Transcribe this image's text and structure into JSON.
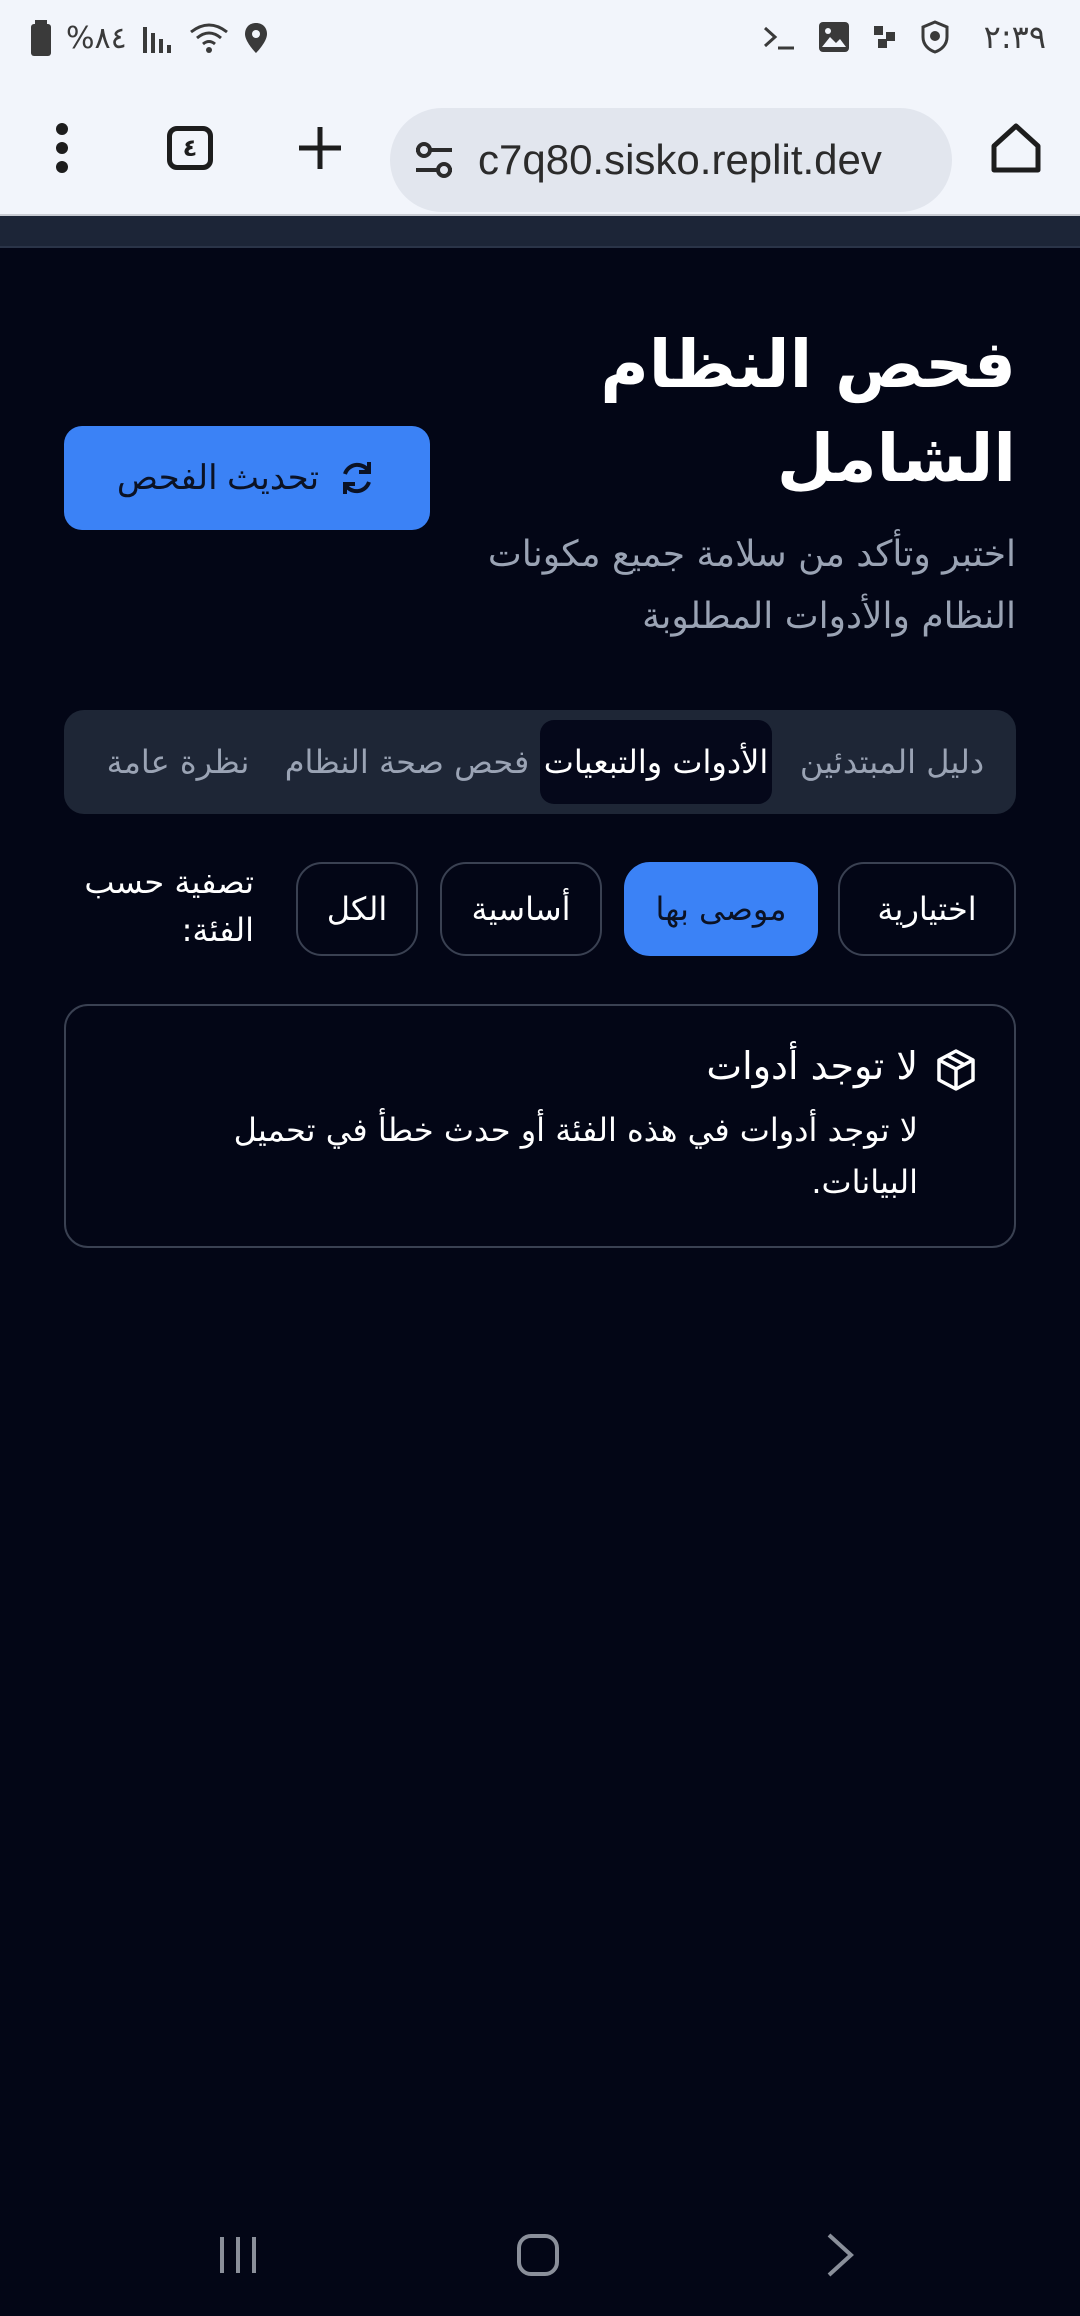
{
  "status_bar": {
    "time": "٢:٣٩",
    "battery": "%٨٤",
    "icons": [
      "terminal-icon",
      "image-icon",
      "shortcut-icon",
      "shield-icon",
      "battery-icon",
      "signal-icon",
      "wifi-icon",
      "location-icon"
    ]
  },
  "browser": {
    "url": "c7q80.sisko.replit.dev",
    "tab_count": "٤",
    "icons": [
      "home-icon",
      "site-settings-icon",
      "new-tab-icon",
      "tabs-icon",
      "menu-icon"
    ]
  },
  "page": {
    "title": "فحص النظام الشامل",
    "subtitle": "اختبر وتأكد من سلامة جميع مكونات النظام والأدوات المطلوبة",
    "refresh_button": "تحديث الفحص"
  },
  "tabs": [
    {
      "label": "دليل المبتدئين",
      "active": false
    },
    {
      "label": "الأدوات والتبعيات",
      "active": true
    },
    {
      "label": "فحص صحة النظام",
      "active": false
    },
    {
      "label": "نظرة عامة",
      "active": false
    }
  ],
  "filter": {
    "label": "تصفية حسب الفئة:",
    "chips": [
      {
        "label": "اختيارية",
        "active": false
      },
      {
        "label": "موصى بها",
        "active": true
      },
      {
        "label": "أساسية",
        "active": false
      },
      {
        "label": "الكل",
        "active": false
      }
    ]
  },
  "empty_state": {
    "title": "لا توجد أدوات",
    "description": "لا توجد أدوات في هذه الفئة أو حدث خطأ في تحميل البيانات.",
    "icon": "package-icon"
  },
  "nav": {
    "icons": [
      "recents-icon",
      "home-nav-icon",
      "back-icon"
    ]
  },
  "colors": {
    "background": "#030616",
    "accent": "#3b82f6",
    "border": "#3a4152",
    "muted_text": "#9aa3b4"
  }
}
